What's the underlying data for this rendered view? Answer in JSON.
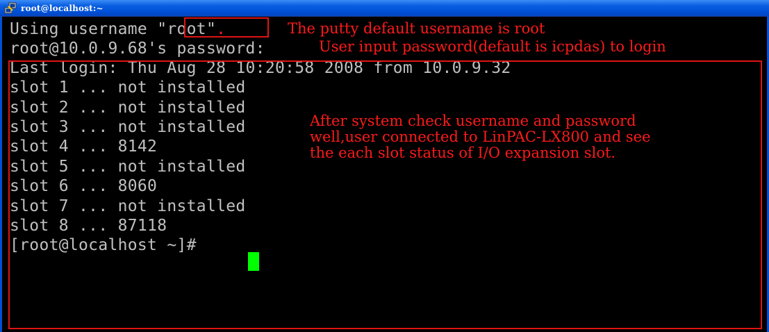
{
  "window": {
    "title": "root@localhost:~",
    "icon": "putty-icon"
  },
  "terminal": {
    "line_prefix_username": "Using username ",
    "username_value": "\"root\"",
    "username_suffix": ".",
    "password_prompt": "root@10.0.9.68's password:",
    "lines": [
      "Last login: Thu Aug 28 10:20:58 2008 from 10.0.9.32",
      "slot 1 ... not installed",
      "slot 2 ... not installed",
      "slot 3 ... not installed",
      "slot 4 ... 8142",
      "slot 5 ... not installed",
      "slot 6 ... 8060",
      "slot 7 ... not installed",
      "slot 8 ... 87118",
      "[root@localhost ~]# "
    ],
    "cursor_color": "#00ff00"
  },
  "annotations": {
    "username_note": "The putty default username is root",
    "password_note": "User input password(default is icpdas) to login",
    "status_note_lines": [
      "After system check username and password",
      "well,user connected to LinPAC-LX800 and see",
      "the each slot status of I/O expansion slot."
    ],
    "color": "#ff1a1a"
  }
}
